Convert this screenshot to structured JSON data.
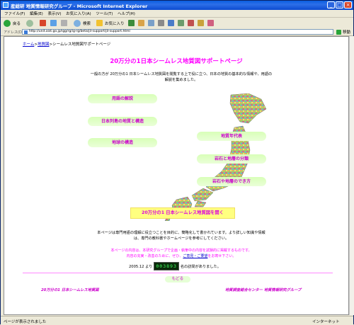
{
  "window": {
    "title": "産総研 地質情報研究グループ - Microsoft Internet Explorer"
  },
  "menu": [
    "ファイル(F)",
    "編集(E)",
    "表示(V)",
    "お気に入り(A)",
    "ツール(T)",
    "ヘルプ(H)"
  ],
  "toolbar": {
    "back": "戻る",
    "search": "検索",
    "favorites": "お気に入り"
  },
  "address": {
    "label": "アドレス(D)",
    "url": "http://unit.aist.go.jp/igg/rg/ig-rg/beta/jil-support/jil-support.html",
    "go": "移動"
  },
  "breadcrumb": {
    "home": "ホーム",
    "sep": ">",
    "section": "地質図",
    "current": "シームレス地質図サポートページ"
  },
  "page": {
    "title": "20万分の1日本シームレス地質図サポートページ",
    "intro": "一般の方が 20万分の1 日本シームレス地質図を閲覧する上で役に立つ、日本の地質の基本的な情報や、用語の解説を集めました。",
    "left_links": [
      "用語の解説",
      "日本列島の地質と構造",
      "地球の構造"
    ],
    "right_links": [
      "地質年代表",
      "岩石と地層の分類",
      "岩石や地層のでき方"
    ],
    "cta": "20万分の1 日本シームレス地質図を開く",
    "description": "本ページは専門用語の理解に役立つことを目的に、簡略化して書かれています。より詳しい知識や情報は、専門の教科書やホームページを参考にしてください。",
    "note_1": "本ページの内容は、本研究グループで企画・執筆中の内容を試験的に掲載するものです。",
    "note_2a": "内容の充実・改善のために、ぜひ、",
    "note_link": "ご意見・ご要望",
    "note_2b": "をお寄せ下さい。",
    "counter_prefix": "2005.12 より",
    "counter_value": "003893",
    "counter_suffix": "名の訪問がありました。",
    "back_label": "もどる",
    "footer_left": "20万分の1 日本シームレス地質図",
    "footer_right": "地質調査総合センター 地質情報研究グループ"
  },
  "status": {
    "left": "ページが表示されました",
    "zone": "インターネット"
  },
  "colors": {
    "accent": "#ff00ff",
    "pill": "#e2ffc8",
    "cta": "#ffff80"
  }
}
